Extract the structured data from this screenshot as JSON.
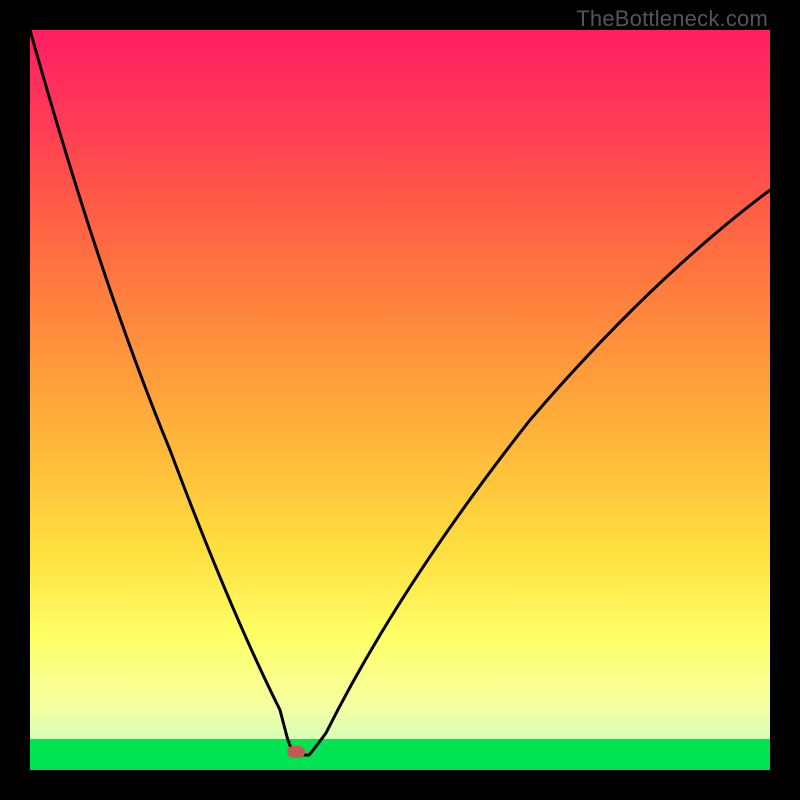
{
  "watermark": "TheBottleneck.com",
  "colors": {
    "frame": "#000000",
    "marker": "#c55a54",
    "gradient_top": "#ff1f63",
    "gradient_bottom": "#00e454"
  },
  "chart_data": {
    "type": "line",
    "title": "",
    "xlabel": "",
    "ylabel": "",
    "xlim": [
      0,
      1
    ],
    "ylim": [
      0,
      1
    ],
    "x": [
      0.0,
      0.05,
      0.1,
      0.15,
      0.2,
      0.25,
      0.3,
      0.345,
      0.36,
      0.377,
      0.4,
      0.45,
      0.5,
      0.55,
      0.6,
      0.65,
      0.7,
      0.75,
      0.8,
      0.85,
      0.9,
      0.95,
      1.0
    ],
    "values": [
      1.0,
      0.84,
      0.69,
      0.54,
      0.4,
      0.27,
      0.15,
      0.05,
      0.02,
      0.02,
      0.05,
      0.13,
      0.21,
      0.29,
      0.36,
      0.43,
      0.49,
      0.55,
      0.6,
      0.65,
      0.7,
      0.74,
      0.78
    ],
    "marker": {
      "x": 0.36,
      "y": 0.02
    },
    "note": "V-shaped deviation curve; minimum at x≈0.36. Values are normalized estimates read from the gradient chart (no axes/ticks provided)."
  }
}
